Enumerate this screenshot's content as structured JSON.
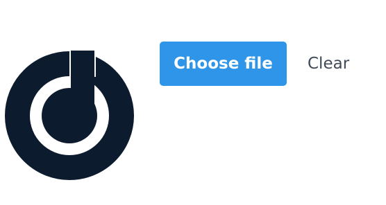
{
  "file_input": {
    "preview_icon": "logo-d-icon",
    "choose_label": "Choose file",
    "clear_label": "Clear"
  },
  "colors": {
    "logo": "#0d1b2e",
    "primary_button": "#2f95e8",
    "primary_button_text": "#ffffff",
    "secondary_text": "#3f4a56",
    "background": "#ffffff"
  }
}
